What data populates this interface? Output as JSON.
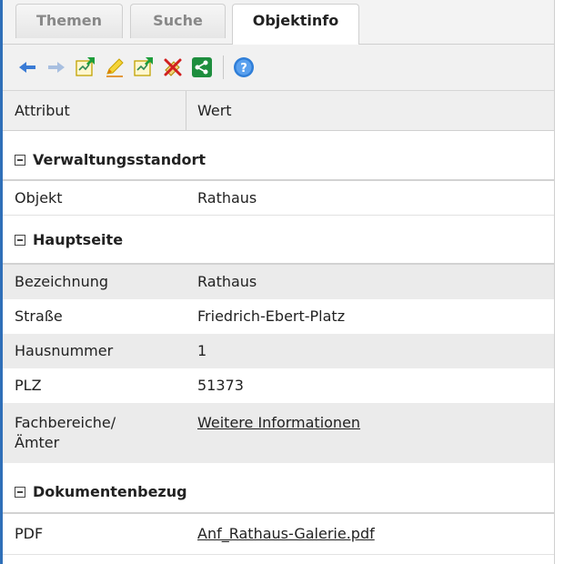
{
  "tabs": [
    {
      "label": "Themen"
    },
    {
      "label": "Suche"
    },
    {
      "label": "Objektinfo"
    }
  ],
  "toolbar": {
    "icons": [
      "back-arrow-icon",
      "forward-arrow-icon",
      "export-icon",
      "edit-icon",
      "export-add-icon",
      "delete-icon",
      "share-icon",
      "help-icon"
    ]
  },
  "header": {
    "attr": "Attribut",
    "value": "Wert"
  },
  "groups": [
    {
      "title": "Verwaltungsstandort",
      "rows": [
        {
          "k": "Objekt",
          "v": "Rathaus"
        }
      ]
    },
    {
      "title": "Hauptseite",
      "rows": [
        {
          "k": "Bezeichnung",
          "v": "Rathaus"
        },
        {
          "k": "Straße",
          "v": "Friedrich-Ebert-Platz"
        },
        {
          "k": "Hausnummer",
          "v": "1"
        },
        {
          "k": "PLZ",
          "v": "51373"
        },
        {
          "k1": "Fachbereiche/",
          "k2": "Ämter",
          "v": "Weitere Informationen"
        }
      ]
    },
    {
      "title": "Dokumentenbezug",
      "rows": [
        {
          "k": "PDF",
          "v": "Anf_Rathaus-Galerie.pdf"
        }
      ]
    }
  ],
  "colors": {
    "accent": "#2f6fb8",
    "row_gray": "#ebebeb"
  }
}
